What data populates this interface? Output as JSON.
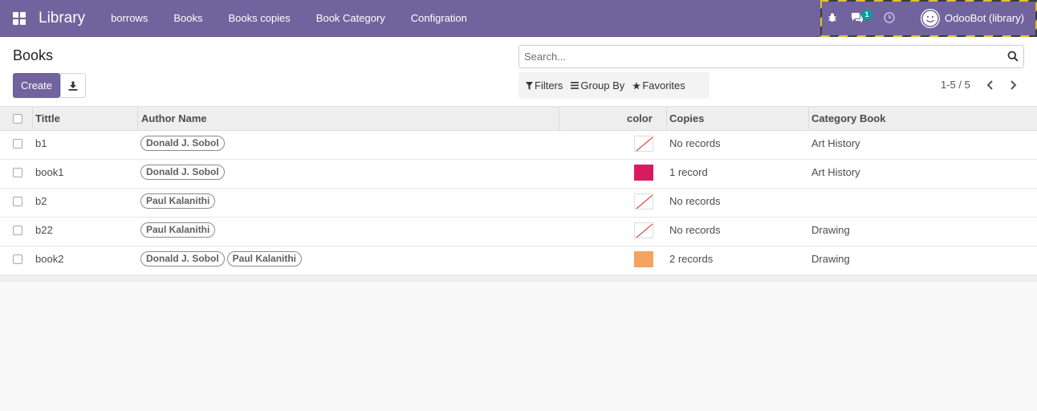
{
  "navbar": {
    "app_title": "Library",
    "menu": [
      "borrows",
      "Books",
      "Books copies",
      "Book Category",
      "Configration"
    ],
    "messages_badge": "1",
    "user": "OdooBot (library)"
  },
  "control_panel": {
    "title": "Books",
    "create_label": "Create",
    "search_placeholder": "Search...",
    "filters_label": "Filters",
    "group_by_label": "Group By",
    "favorites_label": "Favorites",
    "pager": "1-5 / 5"
  },
  "table": {
    "headers": {
      "title": "Tittle",
      "author": "Author Name",
      "color": "color",
      "copies": "Copies",
      "category": "Category Book"
    },
    "rows": [
      {
        "title": "b1",
        "authors": [
          "Donald J. Sobol"
        ],
        "color": "",
        "copies": "No records",
        "category": "Art History"
      },
      {
        "title": "book1",
        "authors": [
          "Donald J. Sobol"
        ],
        "color": "#d81b60",
        "copies": "1 record",
        "category": "Art History"
      },
      {
        "title": "b2",
        "authors": [
          "Paul Kalanithi"
        ],
        "color": "",
        "copies": "No records",
        "category": ""
      },
      {
        "title": "b22",
        "authors": [
          "Paul Kalanithi"
        ],
        "color": "",
        "copies": "No records",
        "category": "Drawing"
      },
      {
        "title": "book2",
        "authors": [
          "Donald J. Sobol",
          "Paul Kalanithi"
        ],
        "color": "#f4a460",
        "copies": "2 records",
        "category": "Drawing"
      }
    ]
  },
  "colors": {
    "brand": "#71639e",
    "highlight": "#e3c227",
    "badge": "#00a09d"
  }
}
